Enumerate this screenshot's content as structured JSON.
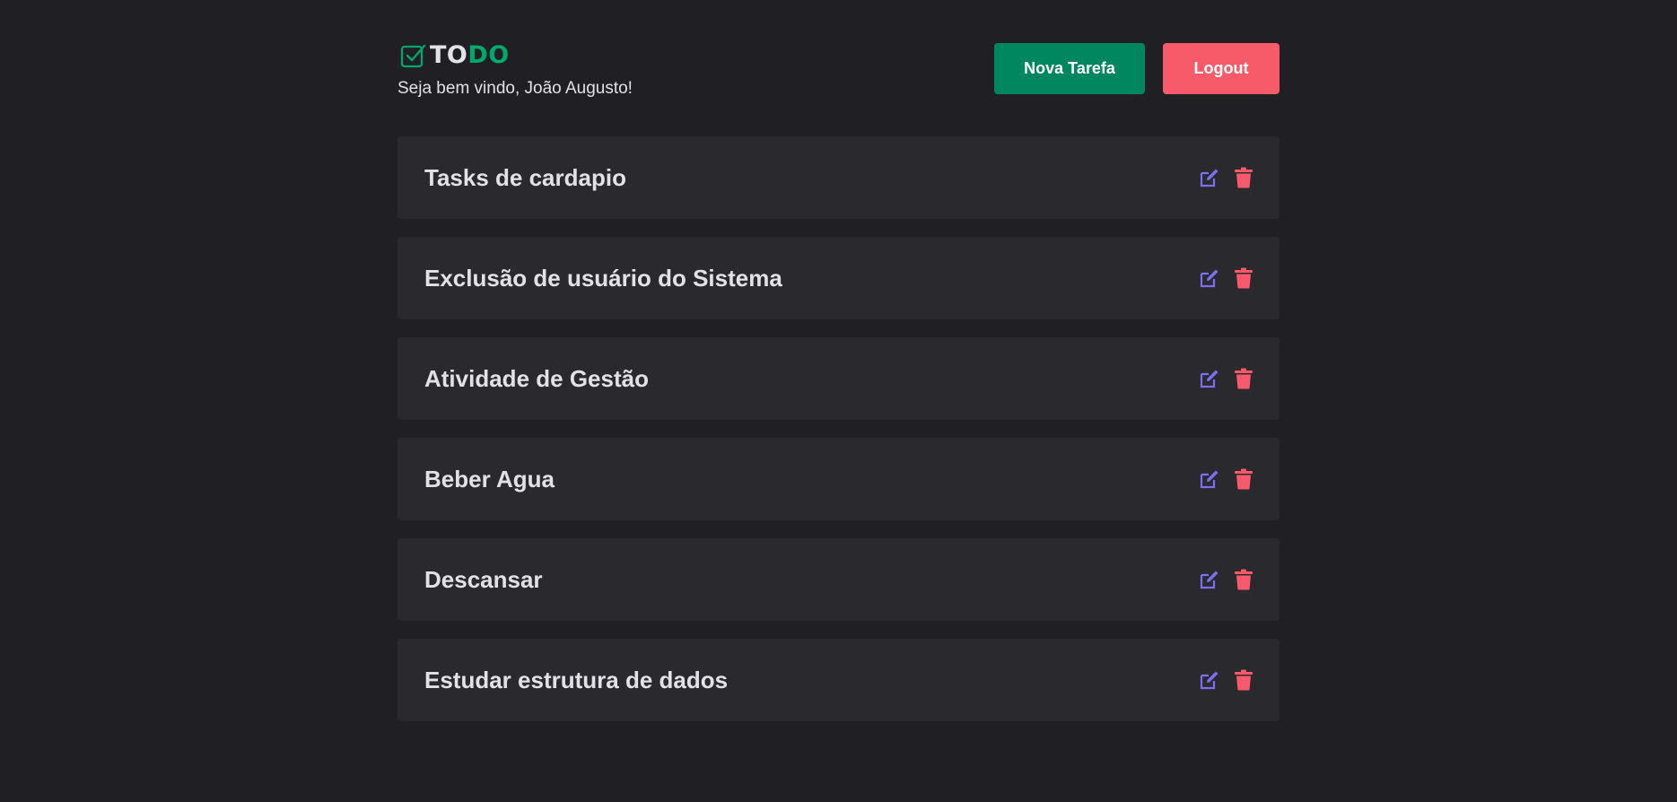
{
  "header": {
    "logo_part1": "TO",
    "logo_part2": "DO",
    "welcome": "Seja bem vindo, João Augusto!",
    "new_task_label": "Nova Tarefa",
    "logout_label": "Logout"
  },
  "tasks": [
    {
      "title": "Tasks de cardapio"
    },
    {
      "title": "Exclusão de usuário do Sistema"
    },
    {
      "title": "Atividade de Gestão"
    },
    {
      "title": "Beber Agua"
    },
    {
      "title": "Descansar"
    },
    {
      "title": "Estudar estrutura de dados"
    }
  ],
  "icons": {
    "logo": "check-square-icon",
    "edit": "edit-icon",
    "delete": "trash-icon"
  },
  "colors": {
    "background": "#202024",
    "card": "#29292e",
    "brand_green": "#00875f",
    "logo_green": "#00a86b",
    "logout_red": "#f75a68",
    "edit_purple": "#8257e5",
    "text": "#e1e1e6"
  }
}
